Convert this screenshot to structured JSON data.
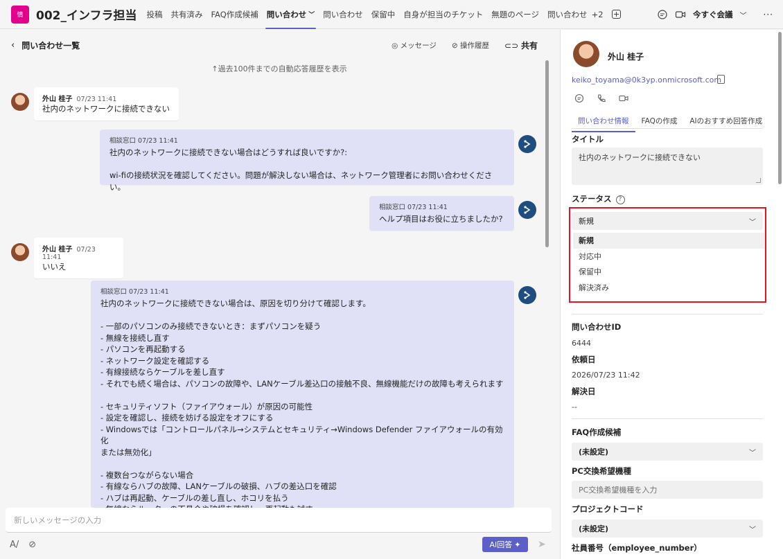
{
  "app": {
    "icon_text": "情",
    "title": "002_インフラ担当",
    "tabs": [
      "投稿",
      "共有済み",
      "FAQ作成候補",
      "問い合わせ",
      "問い合わせ",
      "保留中",
      "自身が担当のチケット",
      "無題のページ",
      "問い合わせ"
    ],
    "more_tabs": "+2",
    "meet_label": "今すぐ会議"
  },
  "chat": {
    "back_title": "問い合わせ一覧",
    "actions": {
      "message": "メッセージ",
      "history": "操作履歴",
      "share": "共有"
    },
    "history_link": "↑過去100件までの自動応答履歴を表示",
    "messages": [
      {
        "sender": "外山 桂子",
        "time": "07/23 11:41",
        "body": "社内のネットワークに接続できない"
      },
      {
        "meta": "相談窓口 07/23 11:41",
        "body": "社内のネットワークに接続できない場合はどうすれば良いですか?:\n\nwi-fiの接続状況を確認してください。問題が解決しない場合は、ネットワーク管理者にお問い合わせください。"
      },
      {
        "meta": "相談窓口 07/23 11:41",
        "body": "ヘルプ項目はお役に立ちましたか?"
      },
      {
        "sender": "外山 桂子",
        "time": "07/23 11:41",
        "body": "いいえ"
      },
      {
        "meta": "相談窓口 07/23 11:41",
        "body": "社内のネットワークに接続できない場合は、原因を切り分けて確認します。\n\n- 一部のパソコンのみ接続できないとき：まずパソコンを疑う\n- 無線を接続し直す\n- パソコンを再起動する\n- ネットワーク設定を確認する\n- 有線接続ならケーブルを差し直す\n- それでも続く場合は、パソコンの故障や、LANケーブル差込口の接触不良、無線機能だけの故障も考えられます\n\n- セキュリティソフト（ファイアウォール）が原因の可能性\n- 設定を確認し、接続を妨げる設定をオフにする\n- Windowsでは「コントロールパネル→システムとセキュリティ→Windows Defender ファイアウォールの有効化\nまたは無効化」\n\n- 複数台つながらない場合\n- 有線ならハブの故障、LANケーブルの破損、ハブの差込口を確認\n- ハブは再起動、ケーブルの差し直し、ホコリを払う\n- 無線ならルーターの不具合や破損を確認し、再起動も試す"
      }
    ],
    "composer_placeholder": "新しいメッセージの入力",
    "ai_button": "AI回答"
  },
  "panel": {
    "name": "外山 桂子",
    "email": "keiko_toyama@0k3yp.onmicrosoft.com",
    "tabs": [
      "問い合わせ情報",
      "FAQの作成",
      "AIのおすすめ回答作成"
    ],
    "title_label": "タイトル",
    "title_value": "社内のネットワークに接続できない",
    "status_label": "ステータス",
    "status_value": "新規",
    "status_options": [
      "新規",
      "対応中",
      "保留中",
      "解決済み"
    ],
    "inquiry_id_label": "問い合わせID",
    "inquiry_id": "6444",
    "request_date_label": "依頼日",
    "request_date": "2026/07/23 11:42",
    "resolved_date_label": "解決日",
    "resolved_date": "--",
    "faq_label": "FAQ作成候補",
    "faq_value": "(未設定)",
    "pc_label": "PC交換希望機種",
    "pc_placeholder": "PC交換希望機種を入力",
    "project_label": "プロジェクトコード",
    "project_value": "(未設定)",
    "employee_label": "社員番号（employee_number）"
  }
}
